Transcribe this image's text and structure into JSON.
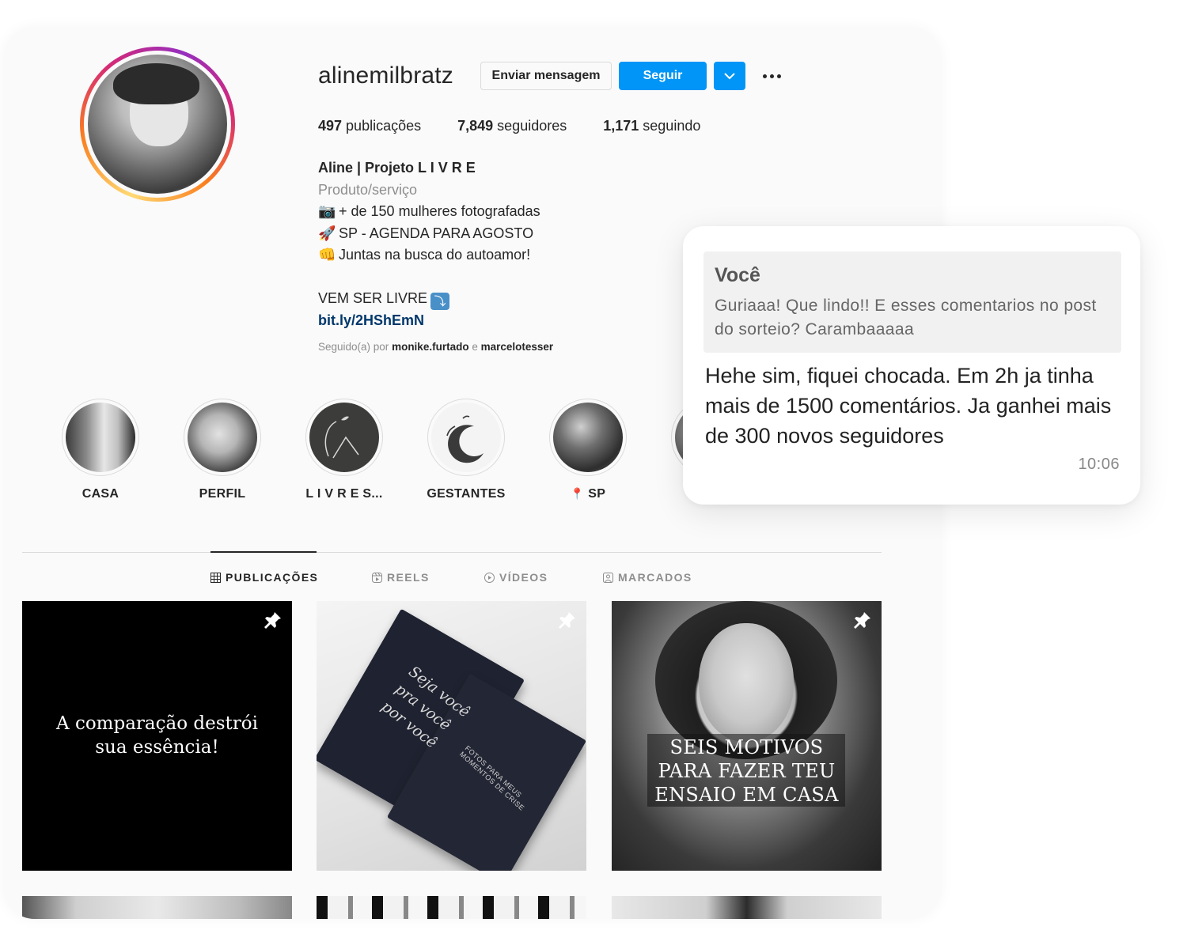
{
  "profile": {
    "username": "alinemilbratz",
    "message_label": "Enviar mensagem",
    "follow_label": "Seguir"
  },
  "stats": {
    "posts_count": "497",
    "posts_label": " publicações",
    "followers_count": "7,849",
    "followers_label": " seguidores",
    "following_count": "1,171",
    "following_label": " seguindo"
  },
  "bio": {
    "name": "Aline | Projeto L I V R E",
    "category": "Produto/serviço",
    "lines": [
      {
        "emoji": "📷",
        "text": "+ de 150 mulheres fotografadas"
      },
      {
        "emoji": "🚀",
        "text": "SP - AGENDA PARA AGOSTO"
      },
      {
        "emoji": "👊",
        "text": "Juntas na busca do autoamor!"
      }
    ],
    "cta": "VEM SER LIVRE",
    "cta_emoji": "⤵",
    "link": "bit.ly/2HShEmN",
    "followed_prefix": "Seguido(a) por ",
    "followed_user1": "monike.furtado",
    "followed_sep": " e ",
    "followed_user2": "marcelotesser"
  },
  "highlights": [
    {
      "label": "CASA"
    },
    {
      "label": "PERFIL"
    },
    {
      "label": "L I V R E S..."
    },
    {
      "label": "GESTANTES"
    },
    {
      "label": "SP",
      "pin": "📍"
    }
  ],
  "tabs": [
    {
      "label": "PUBLICAÇÕES",
      "icon": "grid-icon",
      "active": true
    },
    {
      "label": "REELS",
      "icon": "reels-icon",
      "active": false
    },
    {
      "label": "VÍDEOS",
      "icon": "video-icon",
      "active": false
    },
    {
      "label": "MARCADOS",
      "icon": "tagged-icon",
      "active": false
    }
  ],
  "posts": [
    {
      "line1": "A comparação destrói",
      "line2": "sua essência!"
    },
    {
      "script1": "Seja você",
      "script2": "pra você",
      "script3": "por você",
      "caption1": "FOTOS PARA MEUS",
      "caption2": "MOMENTOS DE CRISE"
    },
    {
      "line1": "SEIS MOTIVOS",
      "line2": "PARA FAZER TEU",
      "line3": "ENSAIO EM CASA"
    }
  ],
  "chat": {
    "quote_author": "Você",
    "quote_text": "Guriaaa! Que lindo!! E esses comentarios no post do sorteio? Carambaaaaa",
    "reply": "Hehe sim, fiquei chocada. Em 2h ja tinha mais de 1500 comentários. Ja ganhei mais de 300 novos seguidores",
    "time": "10:06"
  },
  "colors": {
    "accent": "#0095f6",
    "link": "#00376b",
    "muted": "#8e8e8e"
  }
}
